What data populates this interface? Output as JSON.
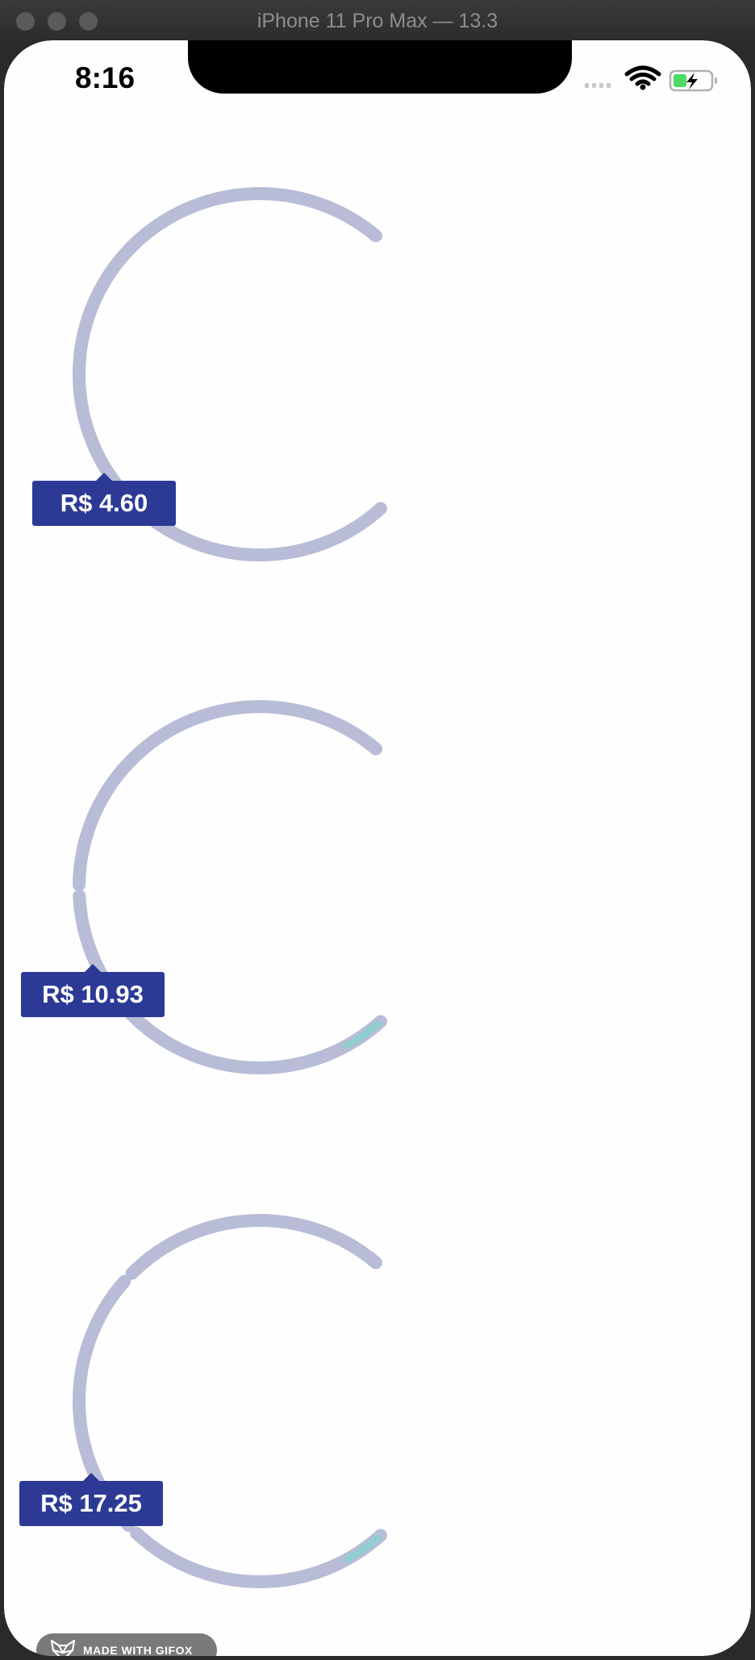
{
  "window": {
    "title": "iPhone 11 Pro Max — 13.3"
  },
  "status_bar": {
    "time": "8:16",
    "icons": [
      "cellular-signal-icon",
      "wifi-icon",
      "battery-charging-icon"
    ]
  },
  "gauges": [
    {
      "price_label": "R$ 4.60",
      "segments": 1,
      "progress": 0.0
    },
    {
      "price_label": "R$ 10.93",
      "segments": 2,
      "progress": 0.05
    },
    {
      "price_label": "R$ 17.25",
      "segments": 3,
      "progress": 0.05
    }
  ],
  "badge": {
    "text": "MADE WITH GIFOX"
  },
  "colors": {
    "track": "#b8bcd6",
    "progress": "#8fcfcf",
    "tag": "#2c3a96",
    "badge": "#7a7a7a"
  }
}
